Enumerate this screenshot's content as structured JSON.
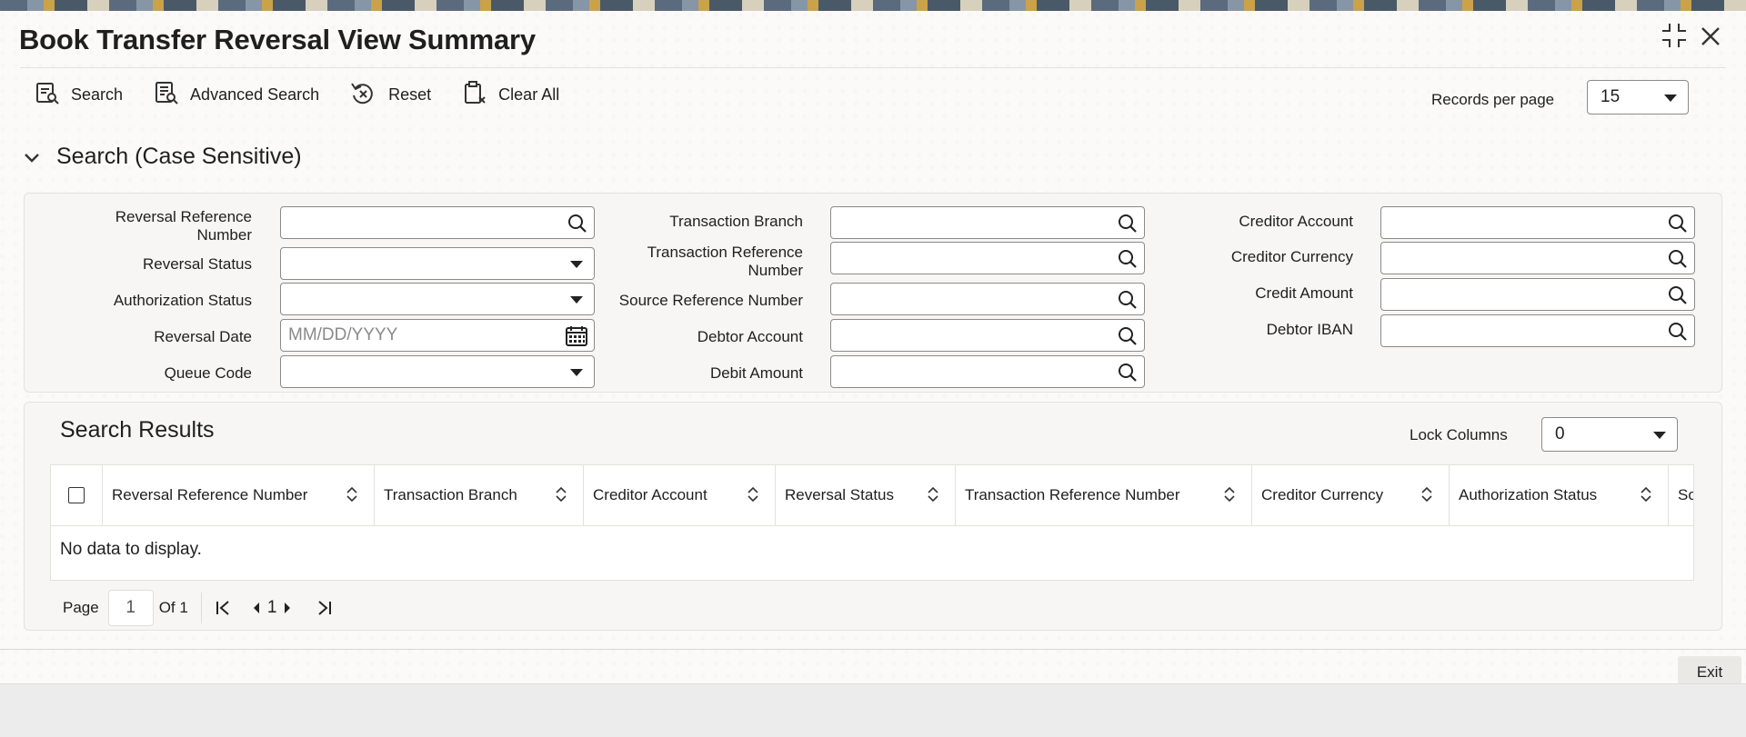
{
  "window": {
    "title": "Book Transfer Reversal View Summary"
  },
  "toolbar": {
    "search_label": "Search",
    "advanced_search_label": "Advanced Search",
    "reset_label": "Reset",
    "clear_all_label": "Clear All",
    "records_per_page_label": "Records per page",
    "records_per_page_value": "15"
  },
  "search_section": {
    "title": "Search (Case Sensitive)",
    "fields": {
      "reversal_reference_number": {
        "label": "Reversal Reference Number",
        "value": ""
      },
      "reversal_status": {
        "label": "Reversal Status",
        "value": ""
      },
      "authorization_status": {
        "label": "Authorization Status",
        "value": ""
      },
      "reversal_date": {
        "label": "Reversal Date",
        "placeholder": "MM/DD/YYYY",
        "value": ""
      },
      "queue_code": {
        "label": "Queue Code",
        "value": ""
      },
      "transaction_branch": {
        "label": "Transaction Branch",
        "value": ""
      },
      "transaction_reference_number": {
        "label": "Transaction Reference Number",
        "value": ""
      },
      "source_reference_number": {
        "label": "Source Reference Number",
        "value": ""
      },
      "debtor_account": {
        "label": "Debtor Account",
        "value": ""
      },
      "debit_amount": {
        "label": "Debit Amount",
        "value": ""
      },
      "creditor_account": {
        "label": "Creditor Account",
        "value": ""
      },
      "creditor_currency": {
        "label": "Creditor Currency",
        "value": ""
      },
      "credit_amount": {
        "label": "Credit Amount",
        "value": ""
      },
      "debtor_iban": {
        "label": "Debtor IBAN",
        "value": ""
      }
    }
  },
  "results": {
    "title": "Search Results",
    "lock_columns_label": "Lock Columns",
    "lock_columns_value": "0",
    "columns": [
      "Reversal Reference Number",
      "Transaction Branch",
      "Creditor Account",
      "Reversal Status",
      "Transaction Reference Number",
      "Creditor Currency",
      "Authorization Status",
      "So"
    ],
    "empty_message": "No data to display.",
    "pager": {
      "page_label": "Page",
      "page_value": "1",
      "of_label": "Of 1",
      "current": "1"
    }
  },
  "footer": {
    "exit_label": "Exit"
  },
  "colors": {
    "accent": "#1f1f1f",
    "panel_bg": "#f7f6f4",
    "field_border": "#8a8a8a"
  },
  "icons": [
    "search-icon",
    "advanced-search-icon",
    "reset-icon",
    "clear-all-icon",
    "maximize-icon",
    "close-icon",
    "calendar-icon",
    "sort-icon"
  ]
}
